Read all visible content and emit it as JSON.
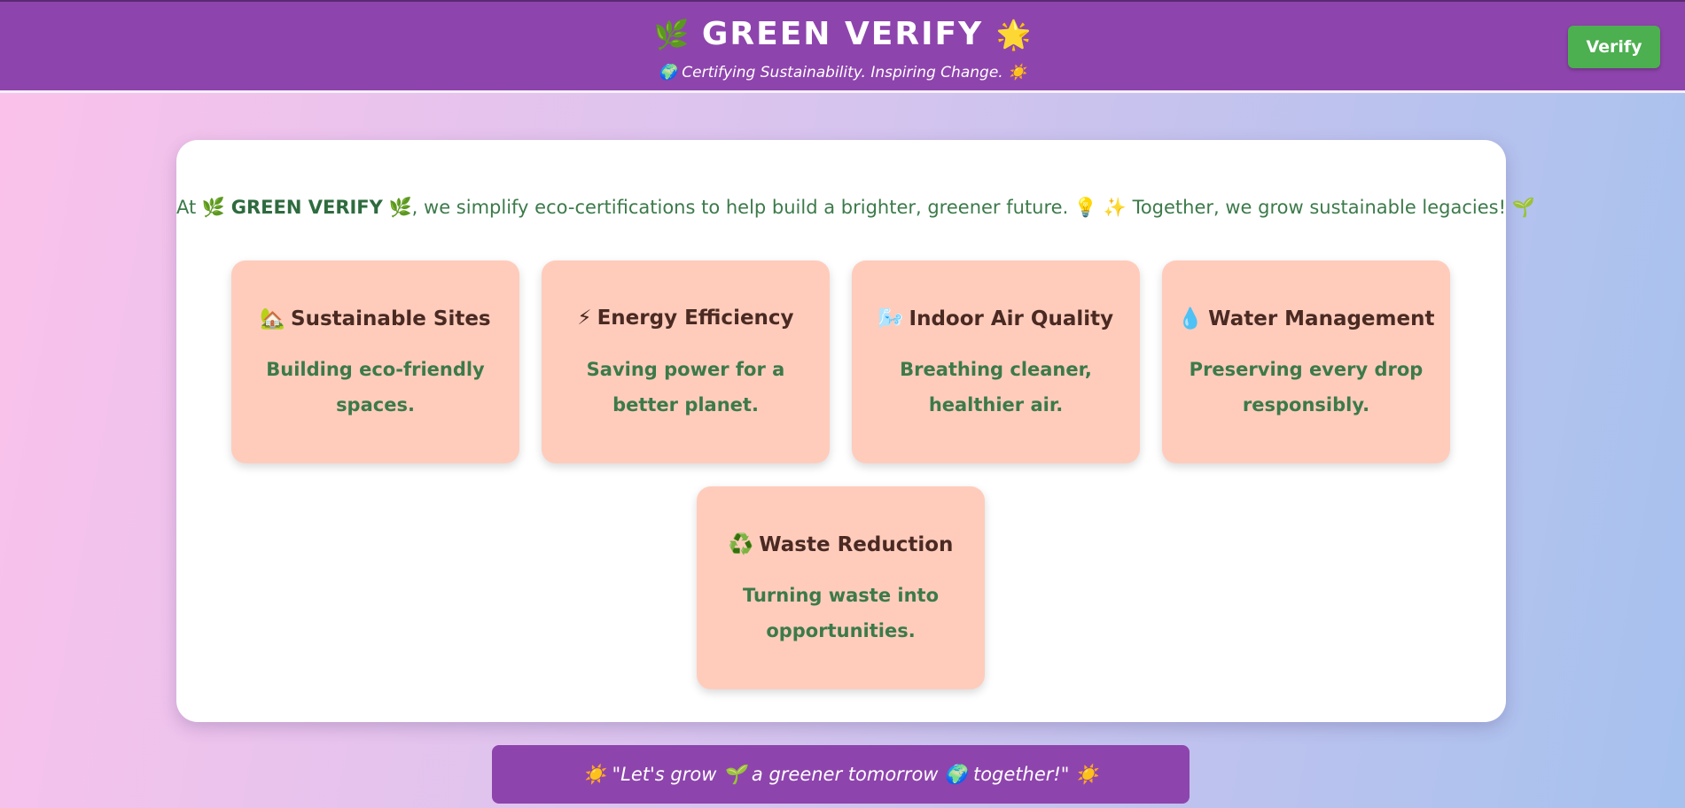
{
  "header": {
    "brand_prefix_emoji": "🌿",
    "brand_name": "GREEN VERIFY",
    "brand_suffix_emoji": "🌟",
    "tagline": "🌍 Certifying Sustainability. Inspiring Change. ☀️",
    "verify_label": "Verify"
  },
  "intro": {
    "lead": "At 🌿 ",
    "brand": "GREEN VERIFY",
    "rest": " 🌿, we simplify eco-certifications to help build a brighter, greener future. 💡 ✨ Together, we grow sustainable legacies! 🌱"
  },
  "cards": [
    {
      "icon": "🏡",
      "title": "Sustainable Sites",
      "desc": "Building eco-friendly spaces."
    },
    {
      "icon": "⚡",
      "title": "Energy Efficiency",
      "desc": "Saving power for a better planet."
    },
    {
      "icon": "🌬️",
      "title": "Indoor Air Quality",
      "desc": "Breathing cleaner, healthier air."
    },
    {
      "icon": "💧",
      "title": "Water Management",
      "desc": "Preserving every drop responsibly."
    },
    {
      "icon": "♻️",
      "title": "Waste Reduction",
      "desc": "Turning waste into opportunities."
    }
  ],
  "footer": {
    "quote": "☀️ \"Let's grow 🌱 a greener tomorrow 🌍 together!\" ☀️"
  },
  "colors": {
    "header_bg": "#8e44ad",
    "button_bg": "#4caf50",
    "card_bg": "#ffccbc",
    "text_green": "#3c7a4a"
  }
}
